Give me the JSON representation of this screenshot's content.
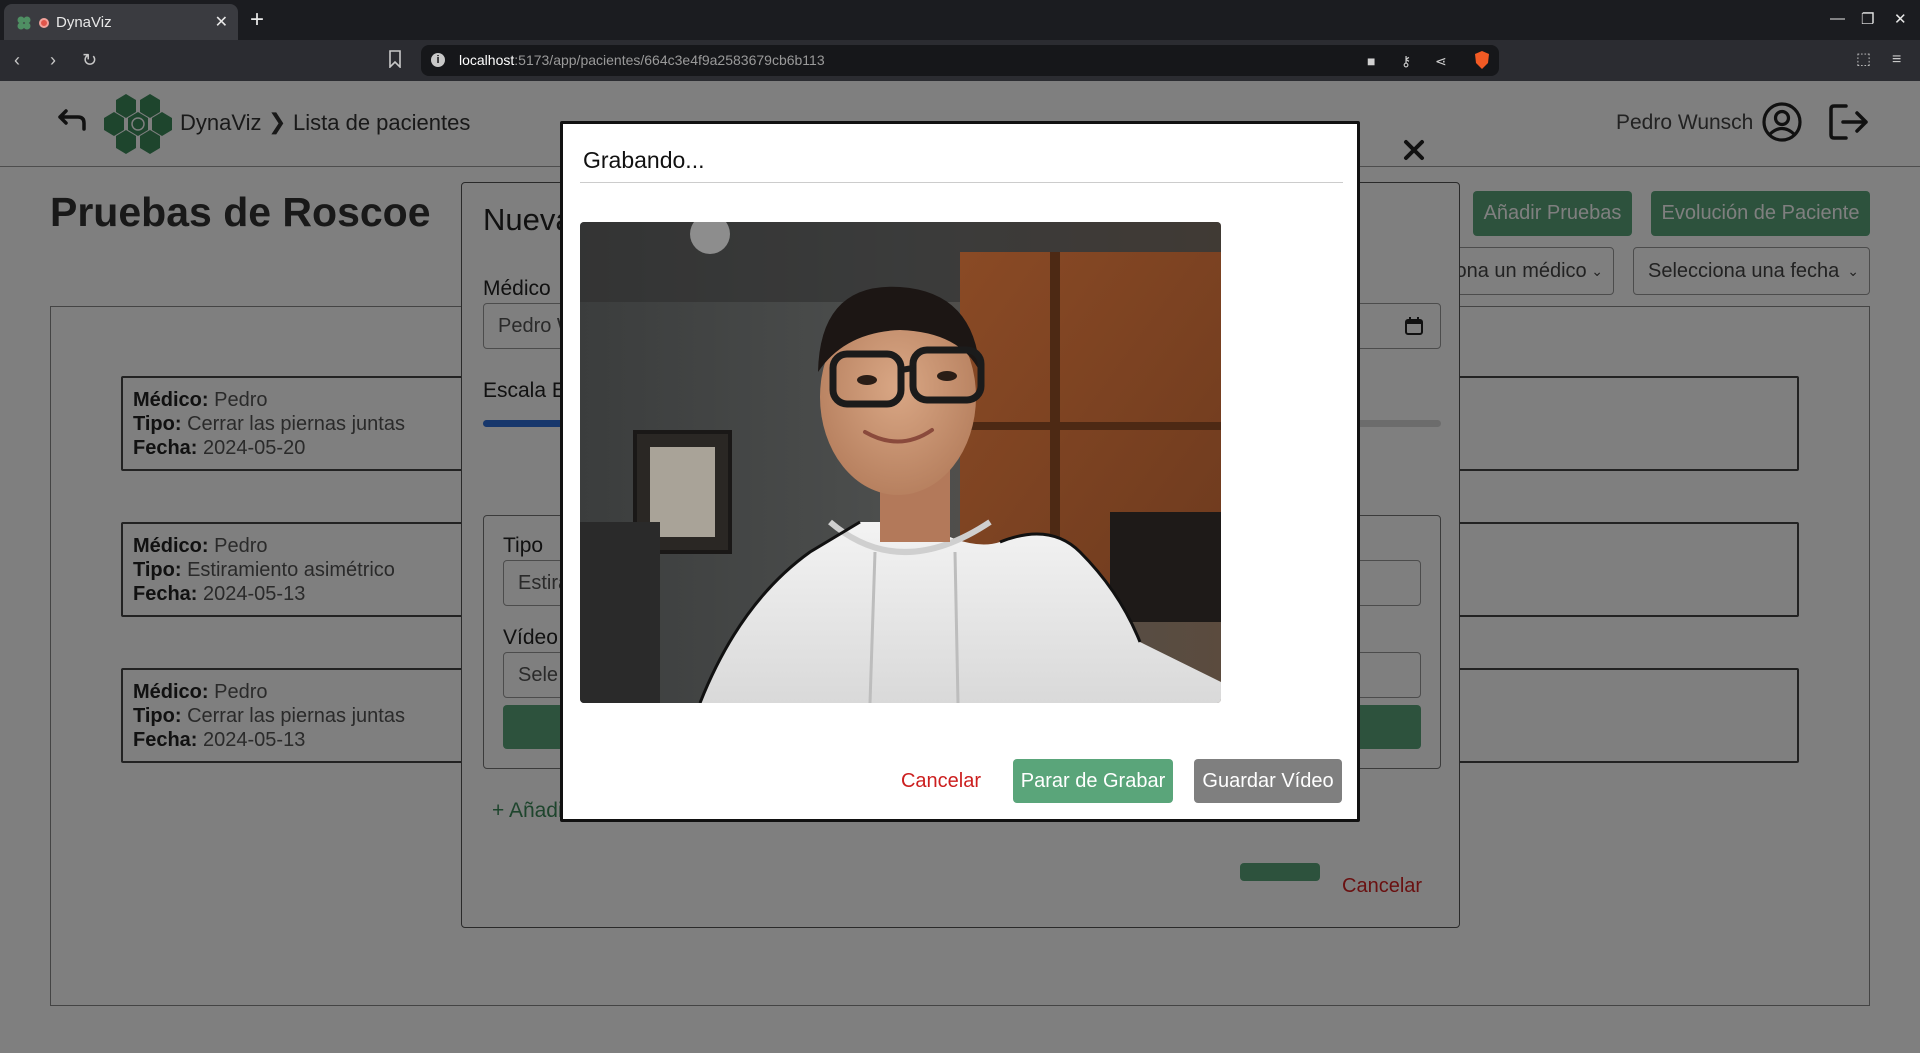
{
  "browser": {
    "tab_title": "DynaViz",
    "tab_close": "✕",
    "new_tab": "+",
    "url_host": "localhost",
    "url_path": ":5173/app/pacientes/664c3e4f9a2583679cb6b113",
    "window_minimize": "—",
    "window_restore": "❐",
    "window_close": "✕"
  },
  "header": {
    "brand": "DynaViz",
    "separator": "❯",
    "breadcrumb": "Lista de pacientes",
    "user_name": "Pedro Wunsch"
  },
  "page": {
    "title": "Pruebas de Roscoe",
    "add_tests_button": "Añadir Pruebas",
    "evolution_button": "Evolución de Paciente",
    "filter_doctor": "Selecciona un médico",
    "filter_date": "Selecciona una fecha"
  },
  "tests": [
    {
      "medico_label": "Médico:",
      "medico": "Pedro",
      "tipo_label": "Tipo:",
      "tipo": "Cerrar las piernas juntas",
      "fecha_label": "Fecha:",
      "fecha": "2024-05-20"
    },
    {
      "medico_label": "Médico:",
      "medico": "Pedro",
      "tipo_label": "Tipo:",
      "tipo": "Estiramiento asimétrico",
      "fecha_label": "Fecha:",
      "fecha": "2024-05-13"
    },
    {
      "medico_label": "Médico:",
      "medico": "Pedro",
      "tipo_label": "Tipo:",
      "tipo": "Cerrar las piernas juntas",
      "fecha_label": "Fecha:",
      "fecha": "2024-05-13"
    }
  ],
  "new_test_modal": {
    "title": "Nueva",
    "medico_label": "Médico",
    "medico_value": "Pedro W",
    "escala_label": "Escala E",
    "tipo_label": "Tipo",
    "tipo_value": "Estira",
    "video_label": "Vídeo",
    "video_value": "Sele",
    "add_link": "+ Añadi",
    "cancel": "Cancelar"
  },
  "recording_modal": {
    "title": "Grabando...",
    "close": "✕",
    "cancel_button": "Cancelar",
    "stop_button": "Parar de Grabar",
    "save_button": "Guardar Vídeo"
  },
  "colors": {
    "brand_green": "#5aa57a",
    "danger_red": "#cc1f1f",
    "disabled_gray": "#7f7f7f",
    "progress_blue": "#2e6fd9"
  }
}
